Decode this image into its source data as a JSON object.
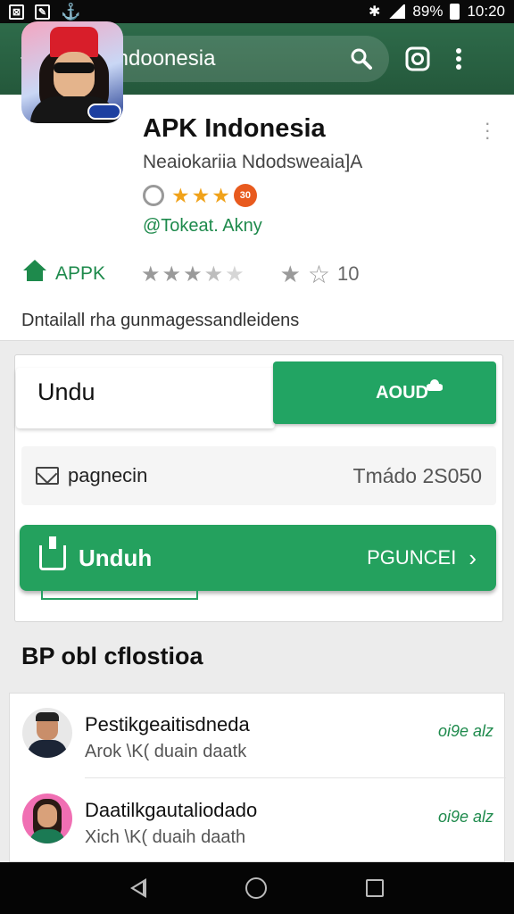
{
  "status_bar": {
    "battery": "89%",
    "time": "10:20"
  },
  "toolbar": {
    "url_text": "Indoonesia"
  },
  "app": {
    "title": "APK Indonesia",
    "subtitle": "Neaiokariia Ndodsweaia]A",
    "rating_chip": "30",
    "developer": "@Tokeat. Akny",
    "meta_label": "APPK",
    "meta_count": "10",
    "description": "Dntailall rha gunmagessandleidens"
  },
  "download": {
    "label": "Undu",
    "add_button": "AOUD",
    "info_left": "pagnecin",
    "info_right": "Tmádo 2S050",
    "big_button_label": "Unduh",
    "big_button_right": "PGUNCEI"
  },
  "section": {
    "title": "BP obl cflostioa"
  },
  "list": [
    {
      "title": "Pestikgeaitisdneda",
      "subtitle": "Arok \\K( duain daatk",
      "right": "oi9e alz"
    },
    {
      "title": "Daatilkgautaliodado",
      "subtitle": "Xich \\K( duaih daath",
      "right": "oi9e alz"
    }
  ],
  "colors": {
    "brand_green": "#22a463",
    "toolbar": "#2e6b4a",
    "star": "#f0a21a"
  }
}
